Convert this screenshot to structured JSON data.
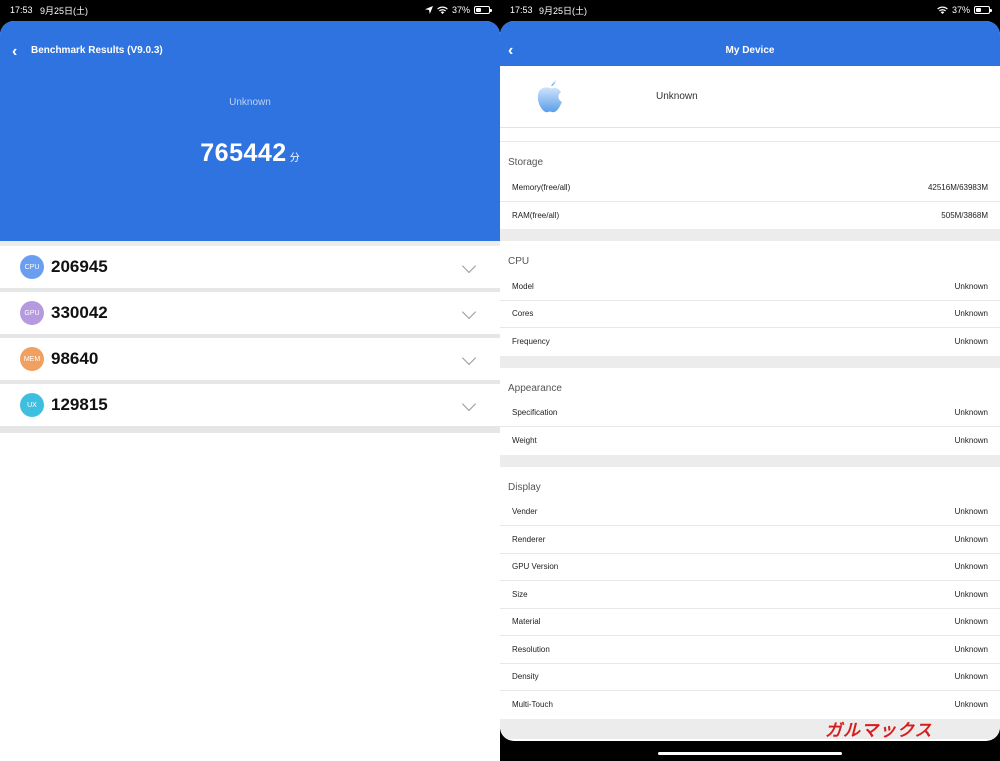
{
  "status_left": {
    "time": "17:53",
    "date": "9月25日(土)",
    "battery": "37%"
  },
  "status_right": {
    "time": "17:53",
    "date": "9月25日(土)",
    "battery": "37%"
  },
  "left": {
    "back_icon": "chevron-left-icon",
    "title": "Benchmark Results (V9.0.3)",
    "device": "Unknown",
    "total_score": "765442",
    "score_unit": "分",
    "scores": [
      {
        "badge": "CPU",
        "value": "206945",
        "color": "#6a9ef0"
      },
      {
        "badge": "GPU",
        "value": "330042",
        "color": "#b59ae0"
      },
      {
        "badge": "MEM",
        "value": "98640",
        "color": "#f0a060"
      },
      {
        "badge": "UX",
        "value": "129815",
        "color": "#3fbfe0"
      }
    ]
  },
  "right": {
    "back_icon": "chevron-left-icon",
    "title": "My Device",
    "device_name": "Unknown",
    "sections": {
      "storage": {
        "title": "Storage",
        "items": [
          {
            "label": "Memory(free/all)",
            "value": "42516M/63983M"
          },
          {
            "label": "RAM(free/all)",
            "value": "505M/3868M"
          }
        ]
      },
      "cpu": {
        "title": "CPU",
        "items": [
          {
            "label": "Model",
            "value": "Unknown"
          },
          {
            "label": "Cores",
            "value": "Unknown"
          },
          {
            "label": "Frequency",
            "value": "Unknown"
          }
        ]
      },
      "appearance": {
        "title": "Appearance",
        "items": [
          {
            "label": "Specification",
            "value": "Unknown"
          },
          {
            "label": "Weight",
            "value": "Unknown"
          }
        ]
      },
      "display": {
        "title": "Display",
        "items": [
          {
            "label": "Vender",
            "value": "Unknown"
          },
          {
            "label": "Renderer",
            "value": "Unknown"
          },
          {
            "label": "GPU Version",
            "value": "Unknown"
          },
          {
            "label": "Size",
            "value": "Unknown"
          },
          {
            "label": "Material",
            "value": "Unknown"
          },
          {
            "label": "Resolution",
            "value": "Unknown"
          },
          {
            "label": "Density",
            "value": "Unknown"
          },
          {
            "label": "Multi-Touch",
            "value": "Unknown"
          }
        ]
      }
    }
  },
  "watermark": "ガルマックス",
  "colors": {
    "accent": "#2f73e1"
  }
}
